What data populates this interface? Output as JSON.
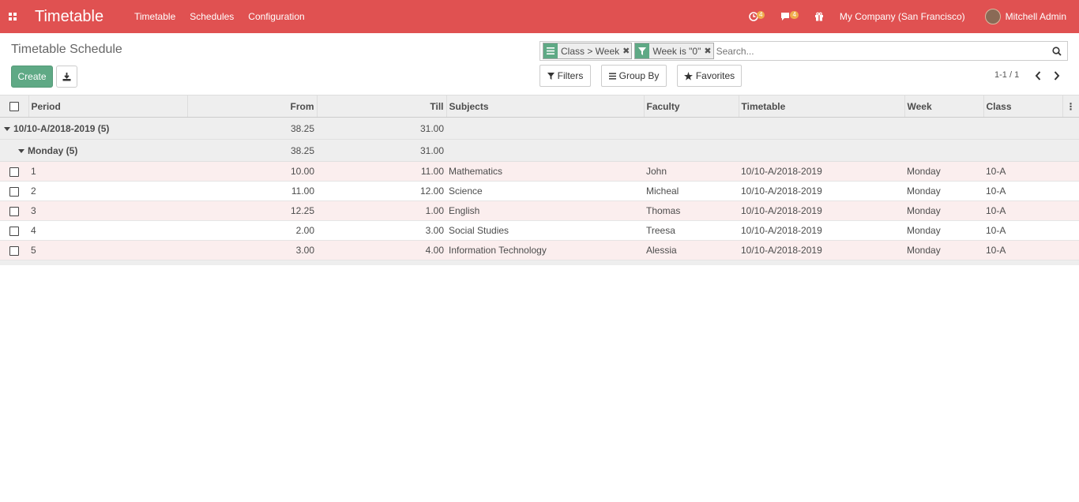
{
  "navbar": {
    "app_title": "Timetable",
    "menu": [
      "Timetable",
      "Schedules",
      "Configuration"
    ],
    "activity_count": "4",
    "message_count": "4",
    "company": "My Company (San Francisco)",
    "user": "Mitchell Admin"
  },
  "control_panel": {
    "title": "Timetable Schedule",
    "create_label": "Create",
    "search": {
      "facet_group": "Class > Week",
      "facet_filter": "Week is \"0\"",
      "placeholder": "Search..."
    },
    "filters_label": "Filters",
    "groupby_label": "Group By",
    "favorites_label": "Favorites",
    "pager": "1-1 / 1"
  },
  "list": {
    "columns": [
      "Period",
      "From",
      "Till",
      "Subjects",
      "Faculty",
      "Timetable",
      "Week",
      "Class"
    ],
    "group1": {
      "label": "10/10-A/2018-2019 (5)",
      "from": "38.25",
      "till": "31.00"
    },
    "group2": {
      "label": "Monday (5)",
      "from": "38.25",
      "till": "31.00"
    },
    "rows": [
      {
        "period": "1",
        "from": "10.00",
        "till": "11.00",
        "subject": "Mathematics",
        "faculty": "John",
        "timetable": "10/10-A/2018-2019",
        "week": "Monday",
        "class": "10-A"
      },
      {
        "period": "2",
        "from": "11.00",
        "till": "12.00",
        "subject": "Science",
        "faculty": "Micheal",
        "timetable": "10/10-A/2018-2019",
        "week": "Monday",
        "class": "10-A"
      },
      {
        "period": "3",
        "from": "12.25",
        "till": "1.00",
        "subject": "English",
        "faculty": "Thomas",
        "timetable": "10/10-A/2018-2019",
        "week": "Monday",
        "class": "10-A"
      },
      {
        "period": "4",
        "from": "2.00",
        "till": "3.00",
        "subject": "Social Studies",
        "faculty": "Treesa",
        "timetable": "10/10-A/2018-2019",
        "week": "Monday",
        "class": "10-A"
      },
      {
        "period": "5",
        "from": "3.00",
        "till": "4.00",
        "subject": "Information Technology",
        "faculty": "Alessia",
        "timetable": "10/10-A/2018-2019",
        "week": "Monday",
        "class": "10-A"
      }
    ]
  },
  "colors": {
    "navbar": "#e05151",
    "primary_button": "#5fa985",
    "row_highlight": "#fbeeee"
  }
}
